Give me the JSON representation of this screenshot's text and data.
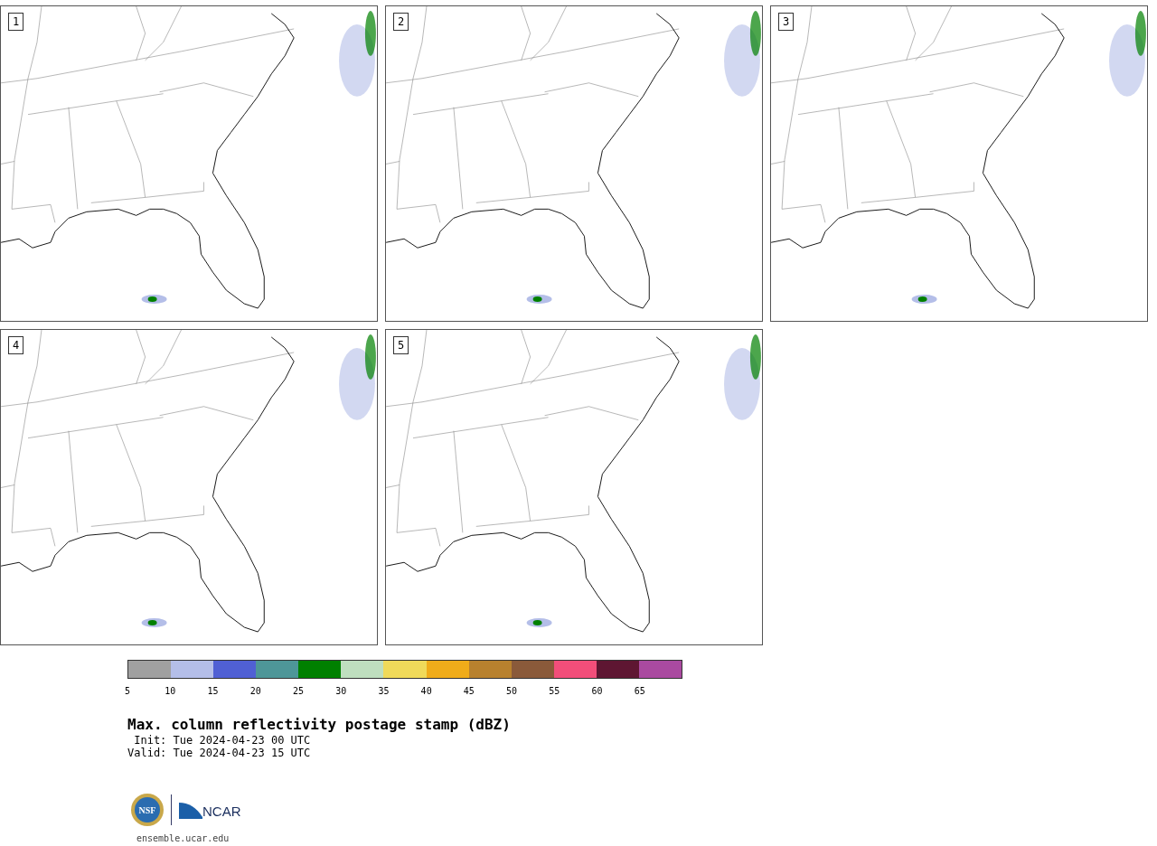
{
  "panels": [
    {
      "label": "1"
    },
    {
      "label": "2"
    },
    {
      "label": "3"
    },
    {
      "label": "4"
    },
    {
      "label": "5"
    }
  ],
  "colorbar": {
    "bins": [
      {
        "color": "#a0a0a0",
        "tick": "5"
      },
      {
        "color": "#b4bee8",
        "tick": "10"
      },
      {
        "color": "#5060d4",
        "tick": "15"
      },
      {
        "color": "#4e9698",
        "tick": "20"
      },
      {
        "color": "#008000",
        "tick": "25"
      },
      {
        "color": "#bfdfbf",
        "tick": "30"
      },
      {
        "color": "#f0da5a",
        "tick": "35"
      },
      {
        "color": "#f0ac1a",
        "tick": "40"
      },
      {
        "color": "#b8812e",
        "tick": "45"
      },
      {
        "color": "#8a5a3a",
        "tick": "50"
      },
      {
        "color": "#f24e7a",
        "tick": "55"
      },
      {
        "color": "#5e1632",
        "tick": "60"
      },
      {
        "color": "#aa4aa0",
        "tick": "65"
      }
    ]
  },
  "title": "Max. column reflectivity postage stamp (dBZ)",
  "init": " Init: Tue 2024-04-23 00 UTC",
  "valid": "Valid: Tue 2024-04-23 15 UTC",
  "logos": {
    "nsf": "NSF",
    "ncar": "NCAR"
  },
  "url": "ensemble.ucar.edu"
}
